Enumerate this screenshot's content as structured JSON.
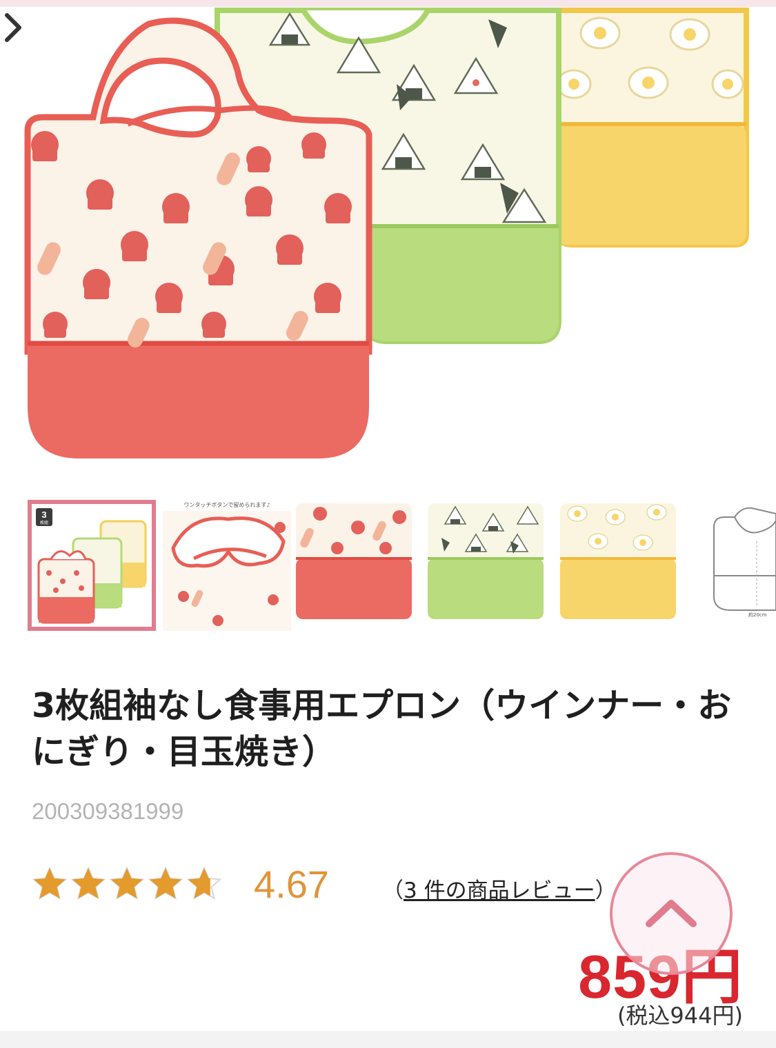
{
  "product": {
    "title": "3枚組袖なし食事用エプロン（ウインナー・おにぎり・目玉焼き）",
    "sku": "200309381999",
    "rating_value": "4.67",
    "rating_fraction": 0.934,
    "review_open": "（",
    "review_link_text": "3 件の商品レビュー",
    "review_close": "）",
    "price": "859円",
    "price_tax_included": "(税込944円)"
  },
  "gallery": {
    "selected_index": 0,
    "badge": {
      "count": "3",
      "label": "枚組"
    },
    "thumb2_caption": "ワンタッチボタンで留められます♪",
    "thumb6_caption": "約20cm"
  },
  "icons": {
    "next": "chevron-right-icon",
    "scroll_top": "chevron-up-icon",
    "star": "star-icon"
  },
  "colors": {
    "price": "#d9272f",
    "rating": "#e0953a",
    "star": "#e59a2c",
    "selected_border": "#df7d8e",
    "bib_red": "#e9665f",
    "bib_green": "#b8dc7e",
    "bib_yellow": "#f8d56a"
  }
}
